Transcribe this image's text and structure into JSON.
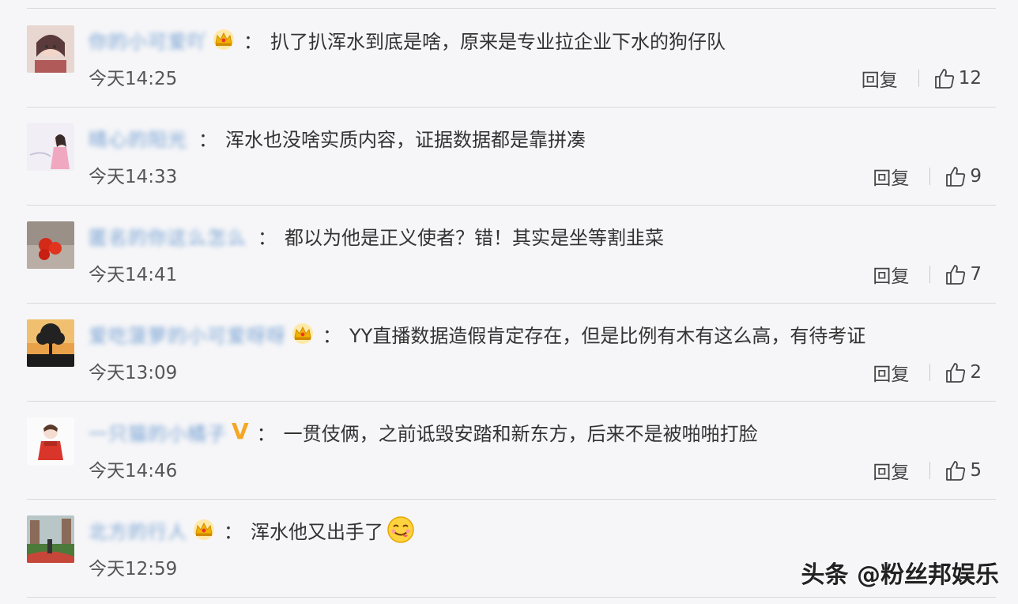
{
  "comments": [
    {
      "username": "你的小可爱吖",
      "badge": "crown",
      "text": "扒了扒浑水到底是啥，原来是专业拉企业下水的狗仔队",
      "time": "今天14:25",
      "reply": "回复",
      "likes": "12",
      "emoji": ""
    },
    {
      "username": "晴心的阳光",
      "badge": "",
      "text": "浑水也没啥实质内容，证据数据都是靠拼凑",
      "time": "今天14:33",
      "reply": "回复",
      "likes": "9",
      "emoji": ""
    },
    {
      "username": "匿名的你这么怎么",
      "badge": "",
      "text": "都以为他是正义使者？错！其实是坐等割韭菜",
      "time": "今天14:41",
      "reply": "回复",
      "likes": "7",
      "emoji": ""
    },
    {
      "username": "爱吃菠萝的小可爱呀呀",
      "badge": "crown",
      "text": "YY直播数据造假肯定存在，但是比例有木有这么高，有待考证",
      "time": "今天13:09",
      "reply": "回复",
      "likes": "2",
      "emoji": ""
    },
    {
      "username": "一只猫的小橘子",
      "badge": "v",
      "text": "一贯伎俩，之前诋毁安踏和新东方，后来不是被啪啪打脸",
      "time": "今天14:46",
      "reply": "回复",
      "likes": "5",
      "emoji": ""
    },
    {
      "username": "北方的行人",
      "badge": "crown",
      "text": "浑水他又出手了",
      "time": "今天12:59",
      "reply": "",
      "likes": "",
      "emoji": "yummy-face"
    }
  ],
  "watermark": "头条 @粉丝邦娱乐",
  "colors": {
    "username": "#4a84c6",
    "crown": "#f0b400",
    "vbadge": "#f5a623",
    "divider": "#d9d9dc",
    "background": "#f6f6f8"
  }
}
